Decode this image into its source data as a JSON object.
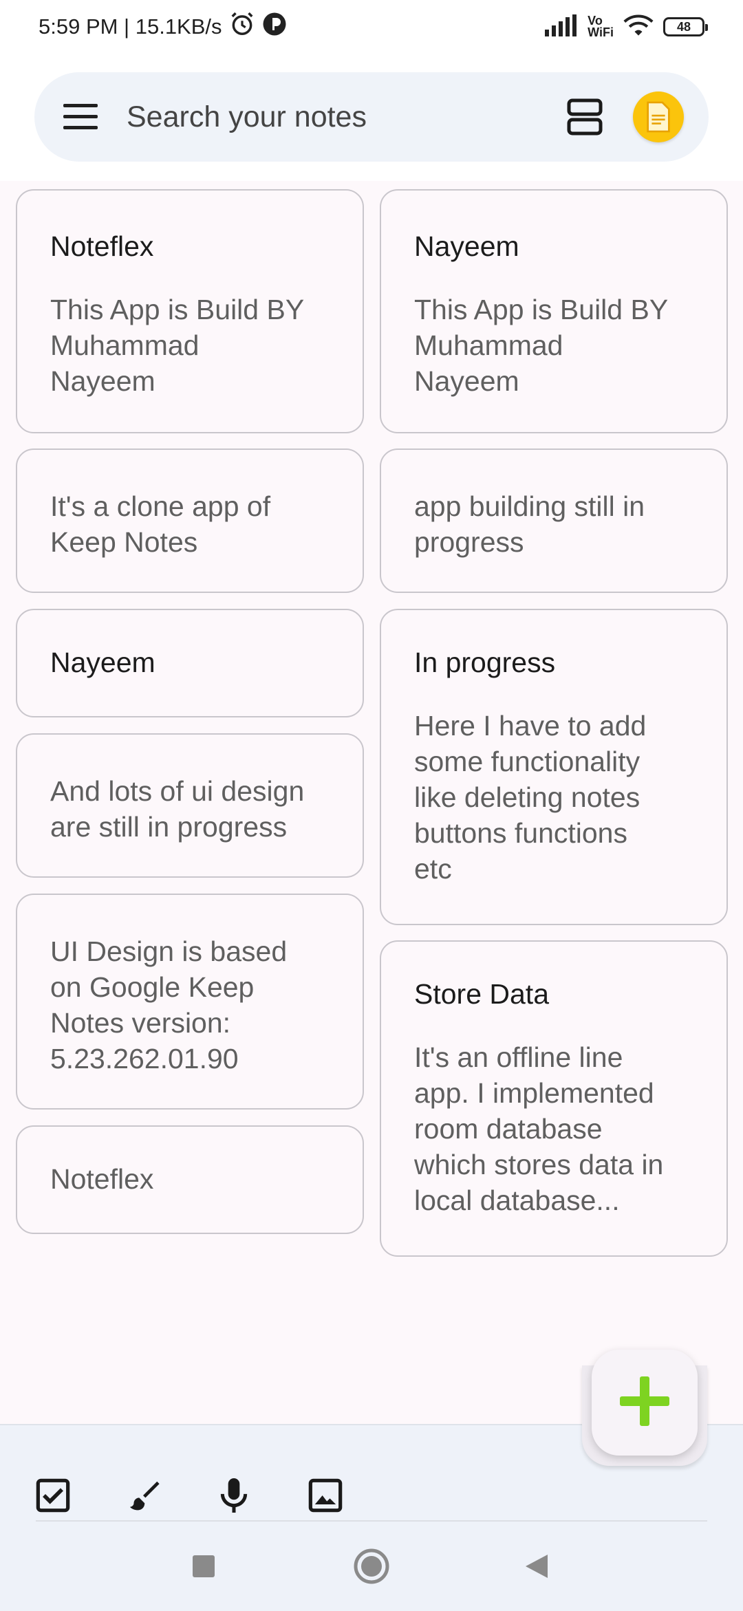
{
  "status_bar": {
    "time_speed": "5:59 PM | 15.1KB/s",
    "vowifi_top": "Vo",
    "vowifi_bottom": "WiFi",
    "battery": "48"
  },
  "search": {
    "placeholder": "Search your notes"
  },
  "brand": {
    "avatar_color": "#fbc40c",
    "fab_plus_color": "#7ed321"
  },
  "notes": {
    "n1": {
      "title": "Noteflex",
      "body": "This App is Build BY\nMuhammad\nNayeem"
    },
    "n2": {
      "title": "Nayeem",
      "body": "This App is Build BY\nMuhammad\nNayeem"
    },
    "n3": {
      "body": "It's a clone app of\nKeep Notes"
    },
    "n4": {
      "body": "app building still in\nprogress"
    },
    "n5": {
      "title": "Nayeem"
    },
    "n6": {
      "title": "In progress",
      "body": "Here I have to add\nsome functionality\nlike deleting notes\nbuttons functions\netc"
    },
    "n7": {
      "body": "And lots of ui design\nare still in progress"
    },
    "n8": {
      "body": "UI Design is based\non Google Keep\nNotes version:\n5.23.262.01.90"
    },
    "n9": {
      "title": "Store Data",
      "body": "It's an offline line\napp. I implemented\nroom database\nwhich stores data in\nlocal database..."
    },
    "n10": {
      "body": "Noteflex"
    }
  },
  "bottom_tools": [
    "checkbox-icon",
    "brush-icon",
    "mic-icon",
    "image-icon"
  ],
  "nav_buttons": [
    "recents-button",
    "home-button",
    "back-button"
  ]
}
